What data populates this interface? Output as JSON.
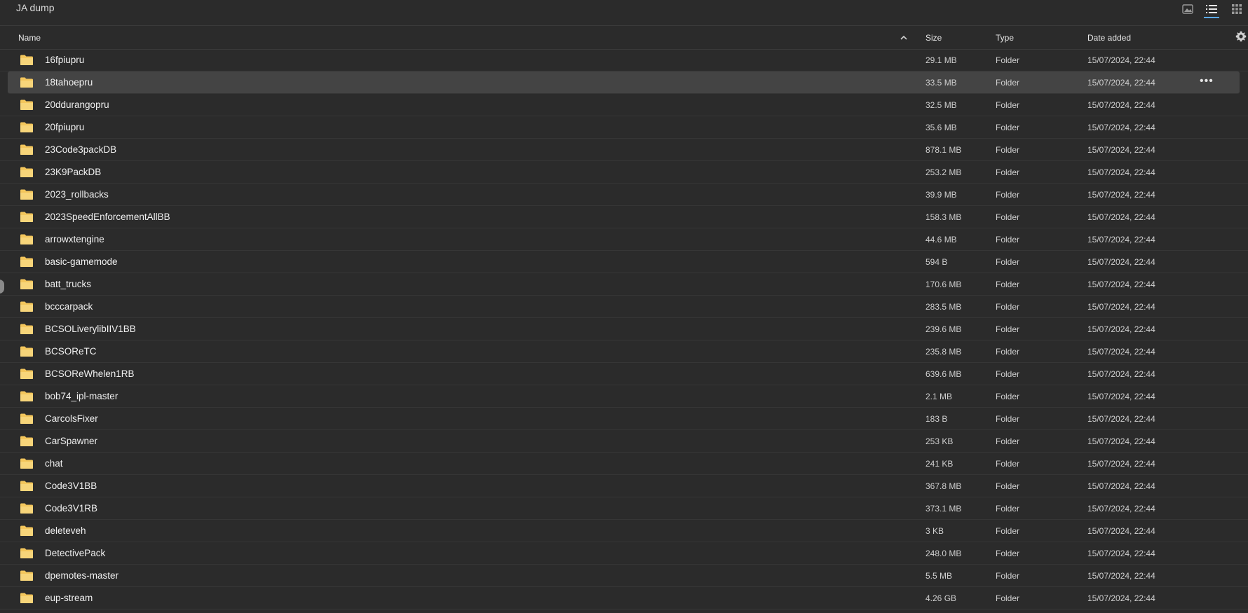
{
  "window": {
    "title": "JA dump"
  },
  "view_modes": [
    {
      "icon": "image-view-icon",
      "active": false
    },
    {
      "icon": "list-view-icon",
      "active": true
    },
    {
      "icon": "grid-view-icon",
      "active": false
    }
  ],
  "columns": {
    "name": "Name",
    "size": "Size",
    "type": "Type",
    "date": "Date added",
    "sort_icon": "chevron-up-icon",
    "settings_icon": "gear-icon"
  },
  "colors": {
    "background": "#2b2b2b",
    "selected_row": "#444444",
    "folder": "#f3c65c",
    "accent": "#5aa9ff"
  },
  "selected_index": 1,
  "rows": [
    {
      "name": "16fpiupru",
      "size": "29.1 MB",
      "type": "Folder",
      "date": "15/07/2024, 22:44"
    },
    {
      "name": "18tahoepru",
      "size": "33.5 MB",
      "type": "Folder",
      "date": "15/07/2024, 22:44"
    },
    {
      "name": "20ddurangopru",
      "size": "32.5 MB",
      "type": "Folder",
      "date": "15/07/2024, 22:44"
    },
    {
      "name": "20fpiupru",
      "size": "35.6 MB",
      "type": "Folder",
      "date": "15/07/2024, 22:44"
    },
    {
      "name": "23Code3packDB",
      "size": "878.1 MB",
      "type": "Folder",
      "date": "15/07/2024, 22:44"
    },
    {
      "name": "23K9PackDB",
      "size": "253.2 MB",
      "type": "Folder",
      "date": "15/07/2024, 22:44"
    },
    {
      "name": "2023_rollbacks",
      "size": "39.9 MB",
      "type": "Folder",
      "date": "15/07/2024, 22:44"
    },
    {
      "name": "2023SpeedEnforcementAllBB",
      "size": "158.3 MB",
      "type": "Folder",
      "date": "15/07/2024, 22:44"
    },
    {
      "name": "arrowxtengine",
      "size": "44.6 MB",
      "type": "Folder",
      "date": "15/07/2024, 22:44"
    },
    {
      "name": "basic-gamemode",
      "size": "594 B",
      "type": "Folder",
      "date": "15/07/2024, 22:44"
    },
    {
      "name": "batt_trucks",
      "size": "170.6 MB",
      "type": "Folder",
      "date": "15/07/2024, 22:44"
    },
    {
      "name": "bcccarpack",
      "size": "283.5 MB",
      "type": "Folder",
      "date": "15/07/2024, 22:44"
    },
    {
      "name": "BCSOLiverylibIIV1BB",
      "size": "239.6 MB",
      "type": "Folder",
      "date": "15/07/2024, 22:44"
    },
    {
      "name": "BCSOReTC",
      "size": "235.8 MB",
      "type": "Folder",
      "date": "15/07/2024, 22:44"
    },
    {
      "name": "BCSOReWhelen1RB",
      "size": "639.6 MB",
      "type": "Folder",
      "date": "15/07/2024, 22:44"
    },
    {
      "name": "bob74_ipl-master",
      "size": "2.1 MB",
      "type": "Folder",
      "date": "15/07/2024, 22:44"
    },
    {
      "name": "CarcolsFixer",
      "size": "183 B",
      "type": "Folder",
      "date": "15/07/2024, 22:44"
    },
    {
      "name": "CarSpawner",
      "size": "253 KB",
      "type": "Folder",
      "date": "15/07/2024, 22:44"
    },
    {
      "name": "chat",
      "size": "241 KB",
      "type": "Folder",
      "date": "15/07/2024, 22:44"
    },
    {
      "name": "Code3V1BB",
      "size": "367.8 MB",
      "type": "Folder",
      "date": "15/07/2024, 22:44"
    },
    {
      "name": "Code3V1RB",
      "size": "373.1 MB",
      "type": "Folder",
      "date": "15/07/2024, 22:44"
    },
    {
      "name": "deleteveh",
      "size": "3 KB",
      "type": "Folder",
      "date": "15/07/2024, 22:44"
    },
    {
      "name": "DetectivePack",
      "size": "248.0 MB",
      "type": "Folder",
      "date": "15/07/2024, 22:44"
    },
    {
      "name": "dpemotes-master",
      "size": "5.5 MB",
      "type": "Folder",
      "date": "15/07/2024, 22:44"
    },
    {
      "name": "eup-stream",
      "size": "4.26 GB",
      "type": "Folder",
      "date": "15/07/2024, 22:44"
    }
  ],
  "row_actions": {
    "more_icon": "more-horizontal-icon",
    "more_label": "•••"
  }
}
